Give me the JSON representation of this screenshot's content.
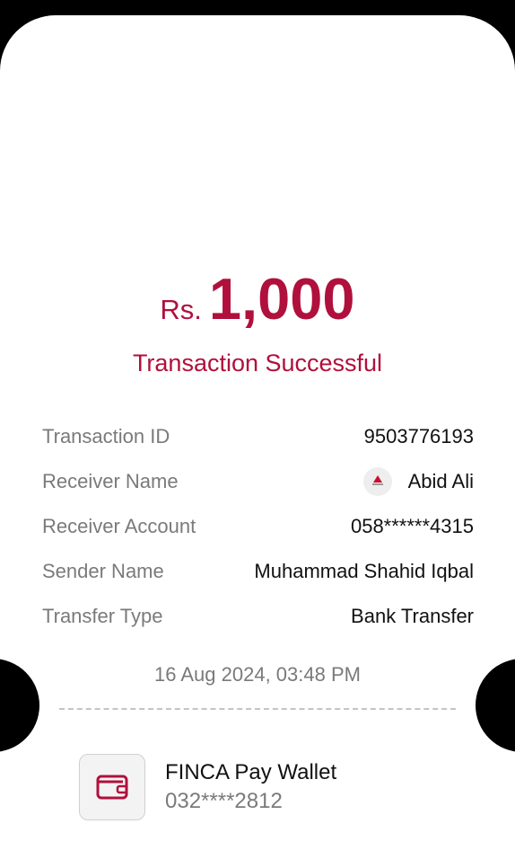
{
  "receipt": {
    "currency": "Rs.",
    "amount": "1,000",
    "status": "Transaction Successful",
    "details": [
      {
        "label": "Transaction ID",
        "value": "9503776193"
      },
      {
        "label": "Receiver Name",
        "value": "Abid Ali",
        "icon": "bank-logo-icon"
      },
      {
        "label": "Receiver Account",
        "value": "058******4315"
      },
      {
        "label": "Sender Name",
        "value": "Muhammad Shahid Iqbal"
      },
      {
        "label": "Transfer Type",
        "value": "Bank Transfer"
      }
    ],
    "datetime": "16 Aug 2024, 03:48 PM"
  },
  "wallet": {
    "icon": "wallet-icon",
    "name": "FINCA Pay Wallet",
    "number": "032****2812"
  },
  "colors": {
    "accent": "#b0103c",
    "label": "#7a7a7a",
    "text": "#111111"
  }
}
